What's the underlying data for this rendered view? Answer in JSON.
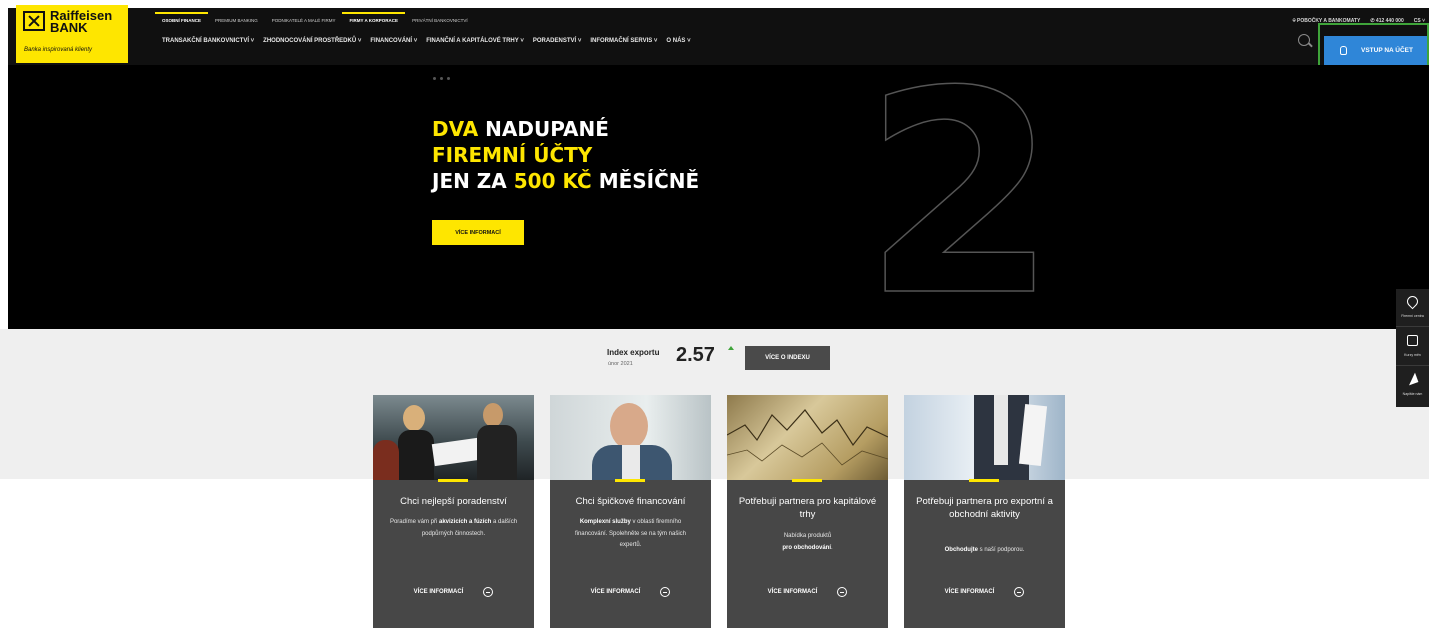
{
  "brand": {
    "name_line1": "Raiffeisen",
    "name_line2": "BANK",
    "tagline": "Banka inspirovaná klienty",
    "accent": "#fee600"
  },
  "top_nav": [
    {
      "label": "OSOBNÍ FINANCE",
      "active": true
    },
    {
      "label": "PREMIUM BANKING",
      "active": false
    },
    {
      "label": "PODNIKATELÉ A MALÉ FIRMY",
      "active": false
    },
    {
      "label": "FIRMY A KORPORACE",
      "active": true
    },
    {
      "label": "PRIVÁTNÍ BANKOVNICTVÍ",
      "active": false
    }
  ],
  "main_nav": [
    "TRANSAKČNÍ BANKOVNICTVÍ ˅",
    "ZHODNOCOVÁNÍ PROSTŘEDKŮ ˅",
    "FINANCOVÁNÍ ˅",
    "FINANČNÍ A KAPITÁLOVÉ TRHY ˅",
    "PORADENSTVÍ ˅",
    "INFORMAČNÍ SERVIS ˅",
    "O NÁS ˅"
  ],
  "utility": {
    "branches": "POBOČKY A BANKOMATY",
    "phone": "412 440 000",
    "language": "CS ˅"
  },
  "login": {
    "label": "VSTUP NA ÚČET",
    "icon": "lock-icon"
  },
  "hero": {
    "line1_yellow": "DVA",
    "line1_white": " NADUPANÉ",
    "line2": "FIREMNÍ ÚČTY",
    "line3_a": "JEN ZA ",
    "line3_yellow": "500 KČ",
    "line3_b": " MĚSÍČNĚ",
    "big_numeral": "2",
    "cta": "VÍCE INFORMACÍ"
  },
  "index": {
    "label": "Index exportu",
    "date": "únor 2021",
    "value": "2.57",
    "trend": "up",
    "cta": "VÍCE O INDEXU"
  },
  "cards": [
    {
      "title": "Chci nejlepší poradenství",
      "desc_parts": [
        "Poradíme vám při ",
        "akvizicích a fúzích",
        " a dalších podpůrných činnostech."
      ],
      "cta": "VÍCE INFORMACÍ"
    },
    {
      "title": "Chci špičkové financování",
      "desc_parts": [
        "",
        "Komplexní služby",
        " v oblasti firemního financování. Spolehněte se na tým našich expertů."
      ],
      "cta": "VÍCE INFORMACÍ"
    },
    {
      "title": "Potřebuji partnera pro kapitálové trhy",
      "desc_parts": [
        "Nabídka produktů ",
        "pro obchodování",
        "."
      ],
      "cta": "VÍCE INFORMACÍ"
    },
    {
      "title": "Potřebuji partnera pro exportní a obchodní aktivity",
      "desc_parts": [
        "",
        "Obchodujte",
        " s naší podporou."
      ],
      "cta": "VÍCE INFORMACÍ"
    }
  ],
  "side_widget": [
    {
      "label": "Firemní centra",
      "icon": "map-pin-icon"
    },
    {
      "label": "Kurzy měn",
      "icon": "currency-icon"
    },
    {
      "label": "Napište nám",
      "icon": "send-icon"
    }
  ]
}
